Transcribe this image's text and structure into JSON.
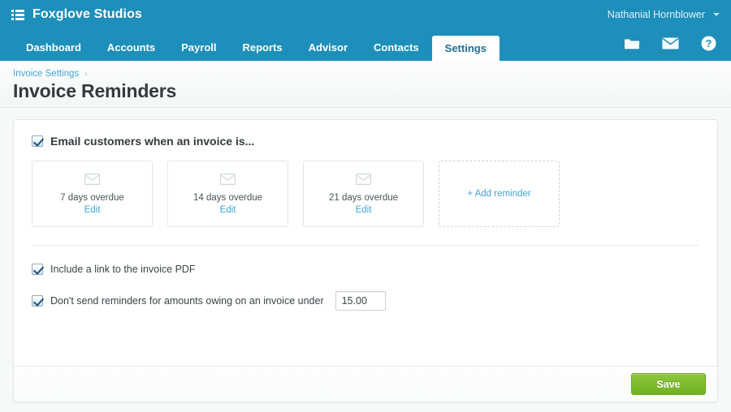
{
  "topbar": {
    "menu_icon": "list-icon",
    "brand": "Foxglove Studios",
    "user_name": "Nathanial Hornblower",
    "caret_icon": "chevron-down-icon"
  },
  "nav": {
    "tabs": [
      {
        "label": "Dashboard",
        "active": false
      },
      {
        "label": "Accounts",
        "active": false
      },
      {
        "label": "Payroll",
        "active": false
      },
      {
        "label": "Reports",
        "active": false
      },
      {
        "label": "Advisor",
        "active": false
      },
      {
        "label": "Contacts",
        "active": false
      },
      {
        "label": "Settings",
        "active": true
      }
    ],
    "icons": [
      {
        "name": "folder-icon"
      },
      {
        "name": "envelope-icon"
      },
      {
        "name": "help-icon"
      }
    ]
  },
  "page": {
    "breadcrumb": "Invoice Settings",
    "breadcrumb_separator": "›",
    "title": "Invoice Reminders"
  },
  "main": {
    "email_section": {
      "checkbox_checked": true,
      "title": "Email customers when an invoice is...",
      "reminders": [
        {
          "icon": "envelope-icon",
          "label": "7 days overdue",
          "edit_label": "Edit"
        },
        {
          "icon": "envelope-icon",
          "label": "14 days overdue",
          "edit_label": "Edit"
        },
        {
          "icon": "envelope-icon",
          "label": "21 days overdue",
          "edit_label": "Edit"
        }
      ],
      "add_reminder_label": "+ Add reminder"
    },
    "options": [
      {
        "checked": true,
        "label": "Include a link to the invoice PDF"
      },
      {
        "checked": true,
        "label": "Don't send reminders for amounts owing on an invoice under"
      }
    ],
    "amount_value": "15.00"
  },
  "footer": {
    "save_label": "Save"
  },
  "colors": {
    "brand_blue": "#1d8fba",
    "link_blue": "#3ca5d6",
    "save_green": "#8cc63e",
    "page_bg": "#f7f9f9"
  }
}
